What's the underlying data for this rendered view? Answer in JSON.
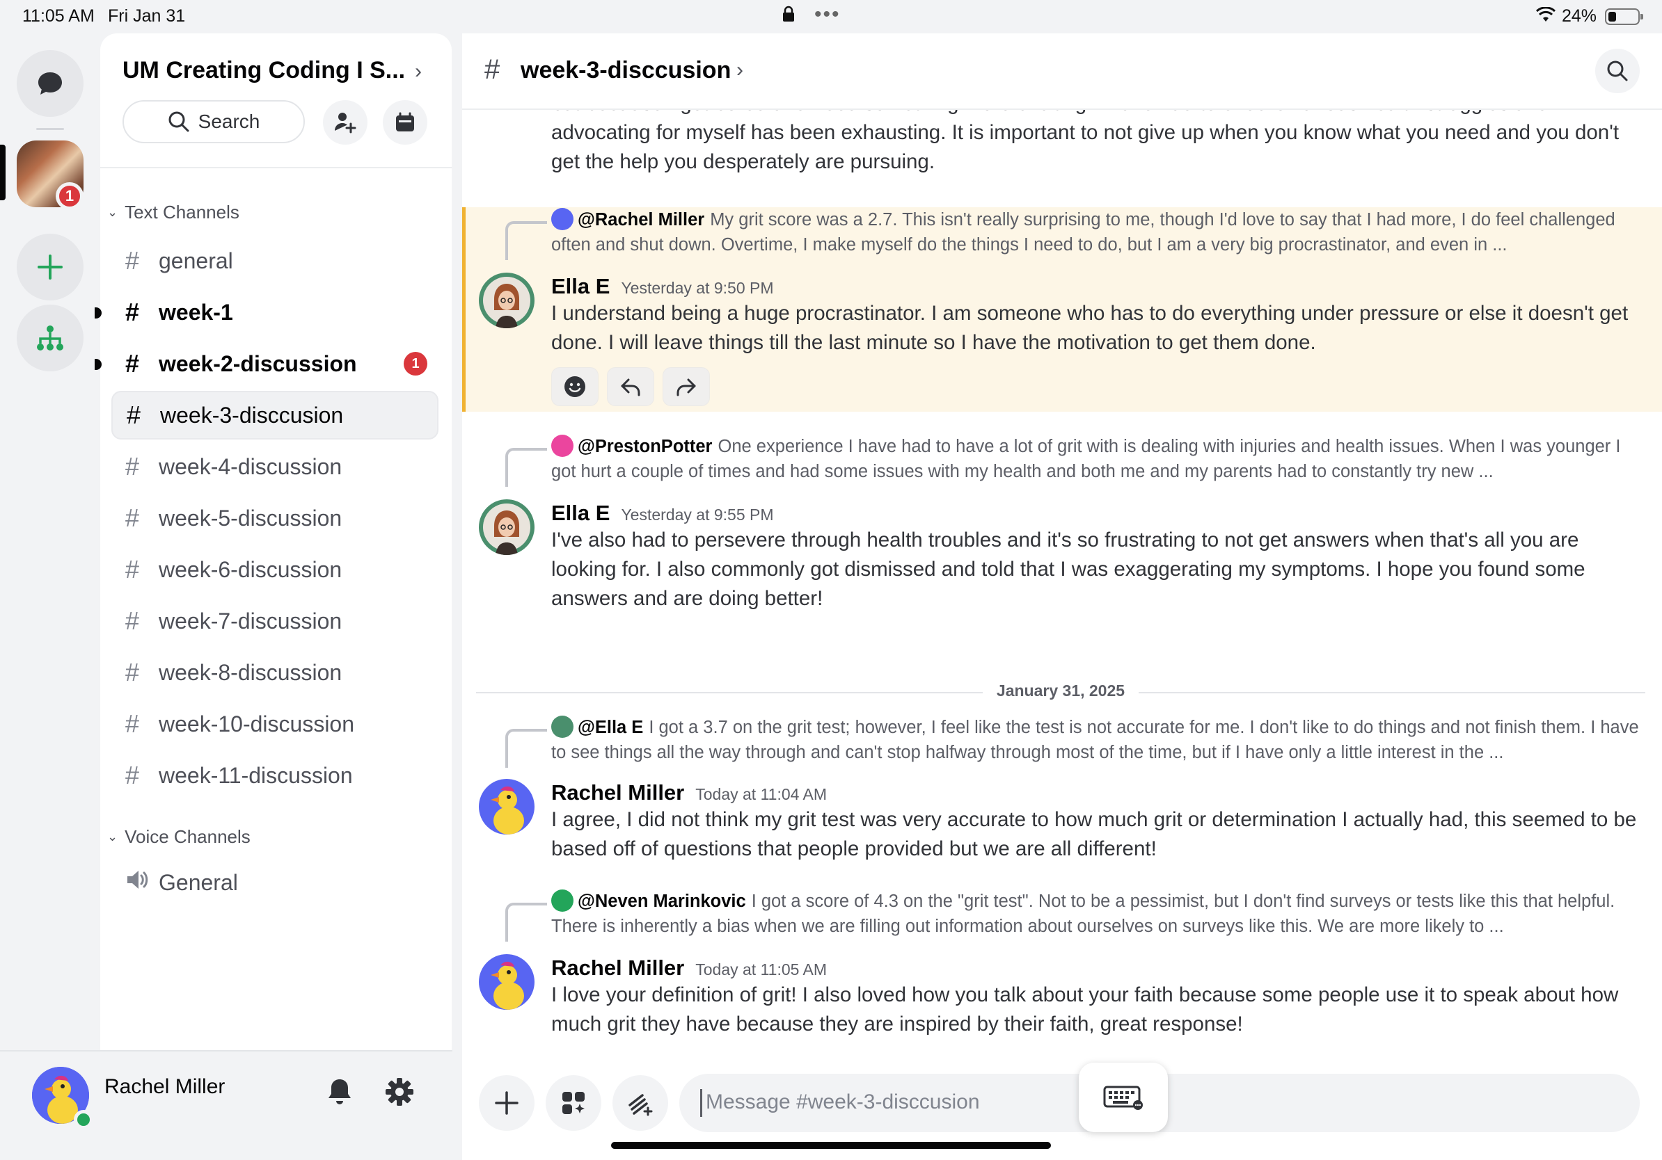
{
  "status_bar": {
    "time": "11:05 AM",
    "date": "Fri Jan 31",
    "battery": "24%"
  },
  "rail": {
    "server_badge": "1"
  },
  "guild": {
    "name": "UM Creating Coding I S...",
    "search_label": "Search"
  },
  "categories": {
    "text": "Text Channels",
    "voice": "Voice Channels"
  },
  "channels": [
    {
      "name": "general"
    },
    {
      "name": "week-1"
    },
    {
      "name": "week-2-discussion",
      "badge": "1"
    },
    {
      "name": "week-3-disccusion"
    },
    {
      "name": "week-4-discussion"
    },
    {
      "name": "week-5-discussion"
    },
    {
      "name": "week-6-discussion"
    },
    {
      "name": "week-7-discussion"
    },
    {
      "name": "week-8-discussion"
    },
    {
      "name": "week-10-discussion"
    },
    {
      "name": "week-11-discussion"
    }
  ],
  "voice_channels": [
    {
      "name": "General"
    }
  ],
  "user": {
    "name": "Rachel  Miller"
  },
  "header": {
    "channel": "week-3-disccusion"
  },
  "partial_message": {
    "line1": "but because I get bored and need something more exciting. I have had to endure various health struggles and",
    "text": "advocating for myself has been exhausting. It is important to not give up when you know what you need and you don't get the help you desperately are pursuing."
  },
  "messages": [
    {
      "reply_to": "@Rachel  Miller",
      "reply_text": "My grit score was a 2.7. This isn't really surprising to me, though I'd love to say that I had more, I do feel challenged often and shut down. Overtime, I make myself do the things I need to do, but I am a very big procrastinator, and even in ...",
      "author": "Ella E",
      "time": "Yesterday at 9:50 PM",
      "text": "I understand being a huge procrastinator. I am someone who has to do everything under pressure or else it doesn't get done. I will leave things till the last minute so I have the motivation to get them done."
    },
    {
      "reply_to": "@PrestonPotter",
      "reply_text": "One experience I have had to have a lot of grit with is dealing with injuries and health issues. When I was younger I got hurt a couple of times and had some issues with my health and both me and my parents had to constantly try new ...",
      "author": "Ella E",
      "time": "Yesterday at 9:55 PM",
      "text": "I've also had to persevere through health troubles and it's so frustrating to not get answers when that's all you are looking for. I also commonly got dismissed and told that I was exaggerating my symptoms. I hope you found some answers and are doing better!"
    },
    {
      "reply_to": "@Ella E",
      "reply_text": "I got a 3.7 on the grit test; however, I feel like the test is not accurate for me. I don't like to do things and not finish them. I have to see things all the way through and can't stop halfway through most of the time, but if I have only a little interest in the ...",
      "author": "Rachel  Miller",
      "time": "Today at 11:04 AM",
      "text": "I agree, I did not think my grit test was very accurate to how much grit or determination I actually had, this seemed to be based off of questions that people provided but we are all different!"
    },
    {
      "reply_to": "@Neven Marinkovic",
      "reply_text": "I got a score of 4.3 on the \"grit test\". Not to be a pessimist, but I don't find surveys or tests like this that helpful. There is inherently a bias when we are filling out information about ourselves on surveys like this. We are more likely to ...",
      "author": "Rachel  Miller",
      "time": "Today at 11:05 AM",
      "text": "I love your definition of grit! I also loved how you talk about your faith because some people use it to speak about how much grit they have because they are inspired by their faith, great response!"
    }
  ],
  "date_separator": "January 31, 2025",
  "composer": {
    "placeholder": "Message #week-3-disccusion"
  },
  "colors": {
    "accent": "#5865f2",
    "highlight": "#fdf6e6",
    "highlight_bar": "#f0b232",
    "badge": "#da373c",
    "online": "#23a55a"
  }
}
